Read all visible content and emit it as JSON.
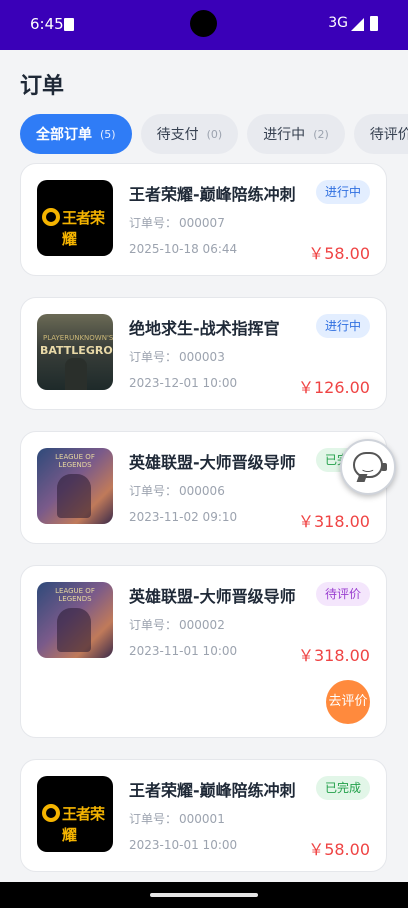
{
  "status_bar": {
    "time": "6:45",
    "network": "3G"
  },
  "page": {
    "title": "订单"
  },
  "tabs": [
    {
      "label": "全部订单",
      "count": "(5)",
      "active": true
    },
    {
      "label": "待支付",
      "count": "(0)"
    },
    {
      "label": "进行中",
      "count": "(2)"
    },
    {
      "label": "待评价",
      "count": ""
    }
  ],
  "order_no_label": "订单号：",
  "orders": [
    {
      "name": "王者荣耀-巅峰陪练冲刺",
      "order_no": "000007",
      "time": "2025-10-18 06:44",
      "price": "￥58.00",
      "status": "进行中",
      "image": "王者荣耀"
    },
    {
      "name": "绝地求生-战术指挥官",
      "order_no": "000003",
      "time": "2023-12-01 10:00",
      "price": "￥126.00",
      "status": "进行中",
      "image": "BATTLEGROUNDS"
    },
    {
      "name": "英雄联盟-大师晋级导师",
      "order_no": "000006",
      "time": "2023-11-02 09:10",
      "price": "￥318.00",
      "status": "已完成",
      "image": "LEAGUE OF LEGENDS"
    },
    {
      "name": "英雄联盟-大师晋级导师",
      "order_no": "000002",
      "time": "2023-11-01 10:00",
      "price": "￥318.00",
      "status": "待评价",
      "action": "去评价",
      "image": "LEAGUE OF LEGENDS"
    },
    {
      "name": "王者荣耀-巅峰陪练冲刺",
      "order_no": "000001",
      "time": "2023-10-01 10:00",
      "price": "￥58.00",
      "status": "已完成",
      "image": "王者荣耀"
    }
  ],
  "pubg_subtitle": "PLAYERUNKNOWN'S",
  "icons": {
    "customer_service": "customer-service-icon"
  }
}
